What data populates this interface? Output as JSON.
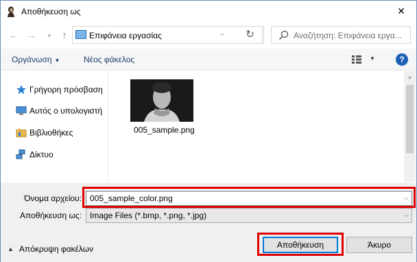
{
  "window": {
    "title": "Αποθήκευση ως",
    "close_label": "✕"
  },
  "nav": {
    "address": "Επιφάνεια εργασίας",
    "search_placeholder": "Αναζήτηση: Επιφάνεια εργα..."
  },
  "toolbar": {
    "organize_label": "Οργάνωση",
    "new_folder_label": "Νέος φάκελος",
    "help_label": "?"
  },
  "sidebar": {
    "items": [
      {
        "label": "Γρήγορη πρόσβαση",
        "icon": "star-pin-icon"
      },
      {
        "label": "Αυτός ο υπολογιστή",
        "icon": "computer-icon"
      },
      {
        "label": "Βιβλιοθήκες",
        "icon": "libraries-icon"
      },
      {
        "label": "Δίκτυο",
        "icon": "network-icon"
      }
    ]
  },
  "files": [
    {
      "name": "005_sample.png"
    }
  ],
  "form": {
    "filename_label": "Όνομα αρχείου:",
    "filename_value": "005_sample_color.png",
    "savetype_label": "Αποθήκευση ως:",
    "savetype_value": "Image Files (*.bmp, *.png, *.jpg)"
  },
  "footer": {
    "hide_folders_label": "Απόκρυψη φακέλων",
    "save_label": "Αποθήκευση",
    "cancel_label": "Άκυρο"
  },
  "colors": {
    "accent": "#0078d7",
    "highlight": "#e00000",
    "form_bg": "#f0f0f0"
  }
}
